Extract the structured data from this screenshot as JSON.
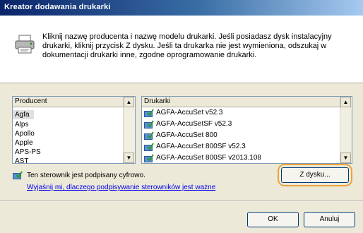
{
  "window": {
    "title": "Kreator dodawania drukarki"
  },
  "header": {
    "icon": "printer-icon",
    "text": "Kliknij nazwę producenta i nazwę modelu drukarki. Jeśli posiadasz dysk instalacyjny drukarki, kliknij przycisk Z dysku. Jeśli ta drukarka nie jest wymieniona, odszukaj w dokumentacji drukarki inne, zgodne oprogramowanie drukarki."
  },
  "manufacturers": {
    "header": "Producent",
    "items": [
      "Agfa",
      "Alps",
      "Apollo",
      "Apple",
      "APS-PS",
      "AST"
    ],
    "selected": "Agfa"
  },
  "printers": {
    "header": "Drukarki",
    "items": [
      "AGFA-AccuSet v52.3",
      "AGFA-AccuSetSF v52.3",
      "AGFA-AccuSet 800",
      "AGFA-AccuSet 800SF v52.3",
      "AGFA-AccuSet 800SF v2013.108"
    ]
  },
  "signature": {
    "text": "Ten sterownik jest podpisany cyfrowo.",
    "link": "Wyjaśnij mi, dlaczego podpisywanie sterowników jest ważne"
  },
  "buttons": {
    "have_disk": "Z dysku...",
    "ok": "OK",
    "cancel": "Anuluj"
  },
  "colors": {
    "highlight": "#f0a33b",
    "title_bar": "#0a246a"
  }
}
